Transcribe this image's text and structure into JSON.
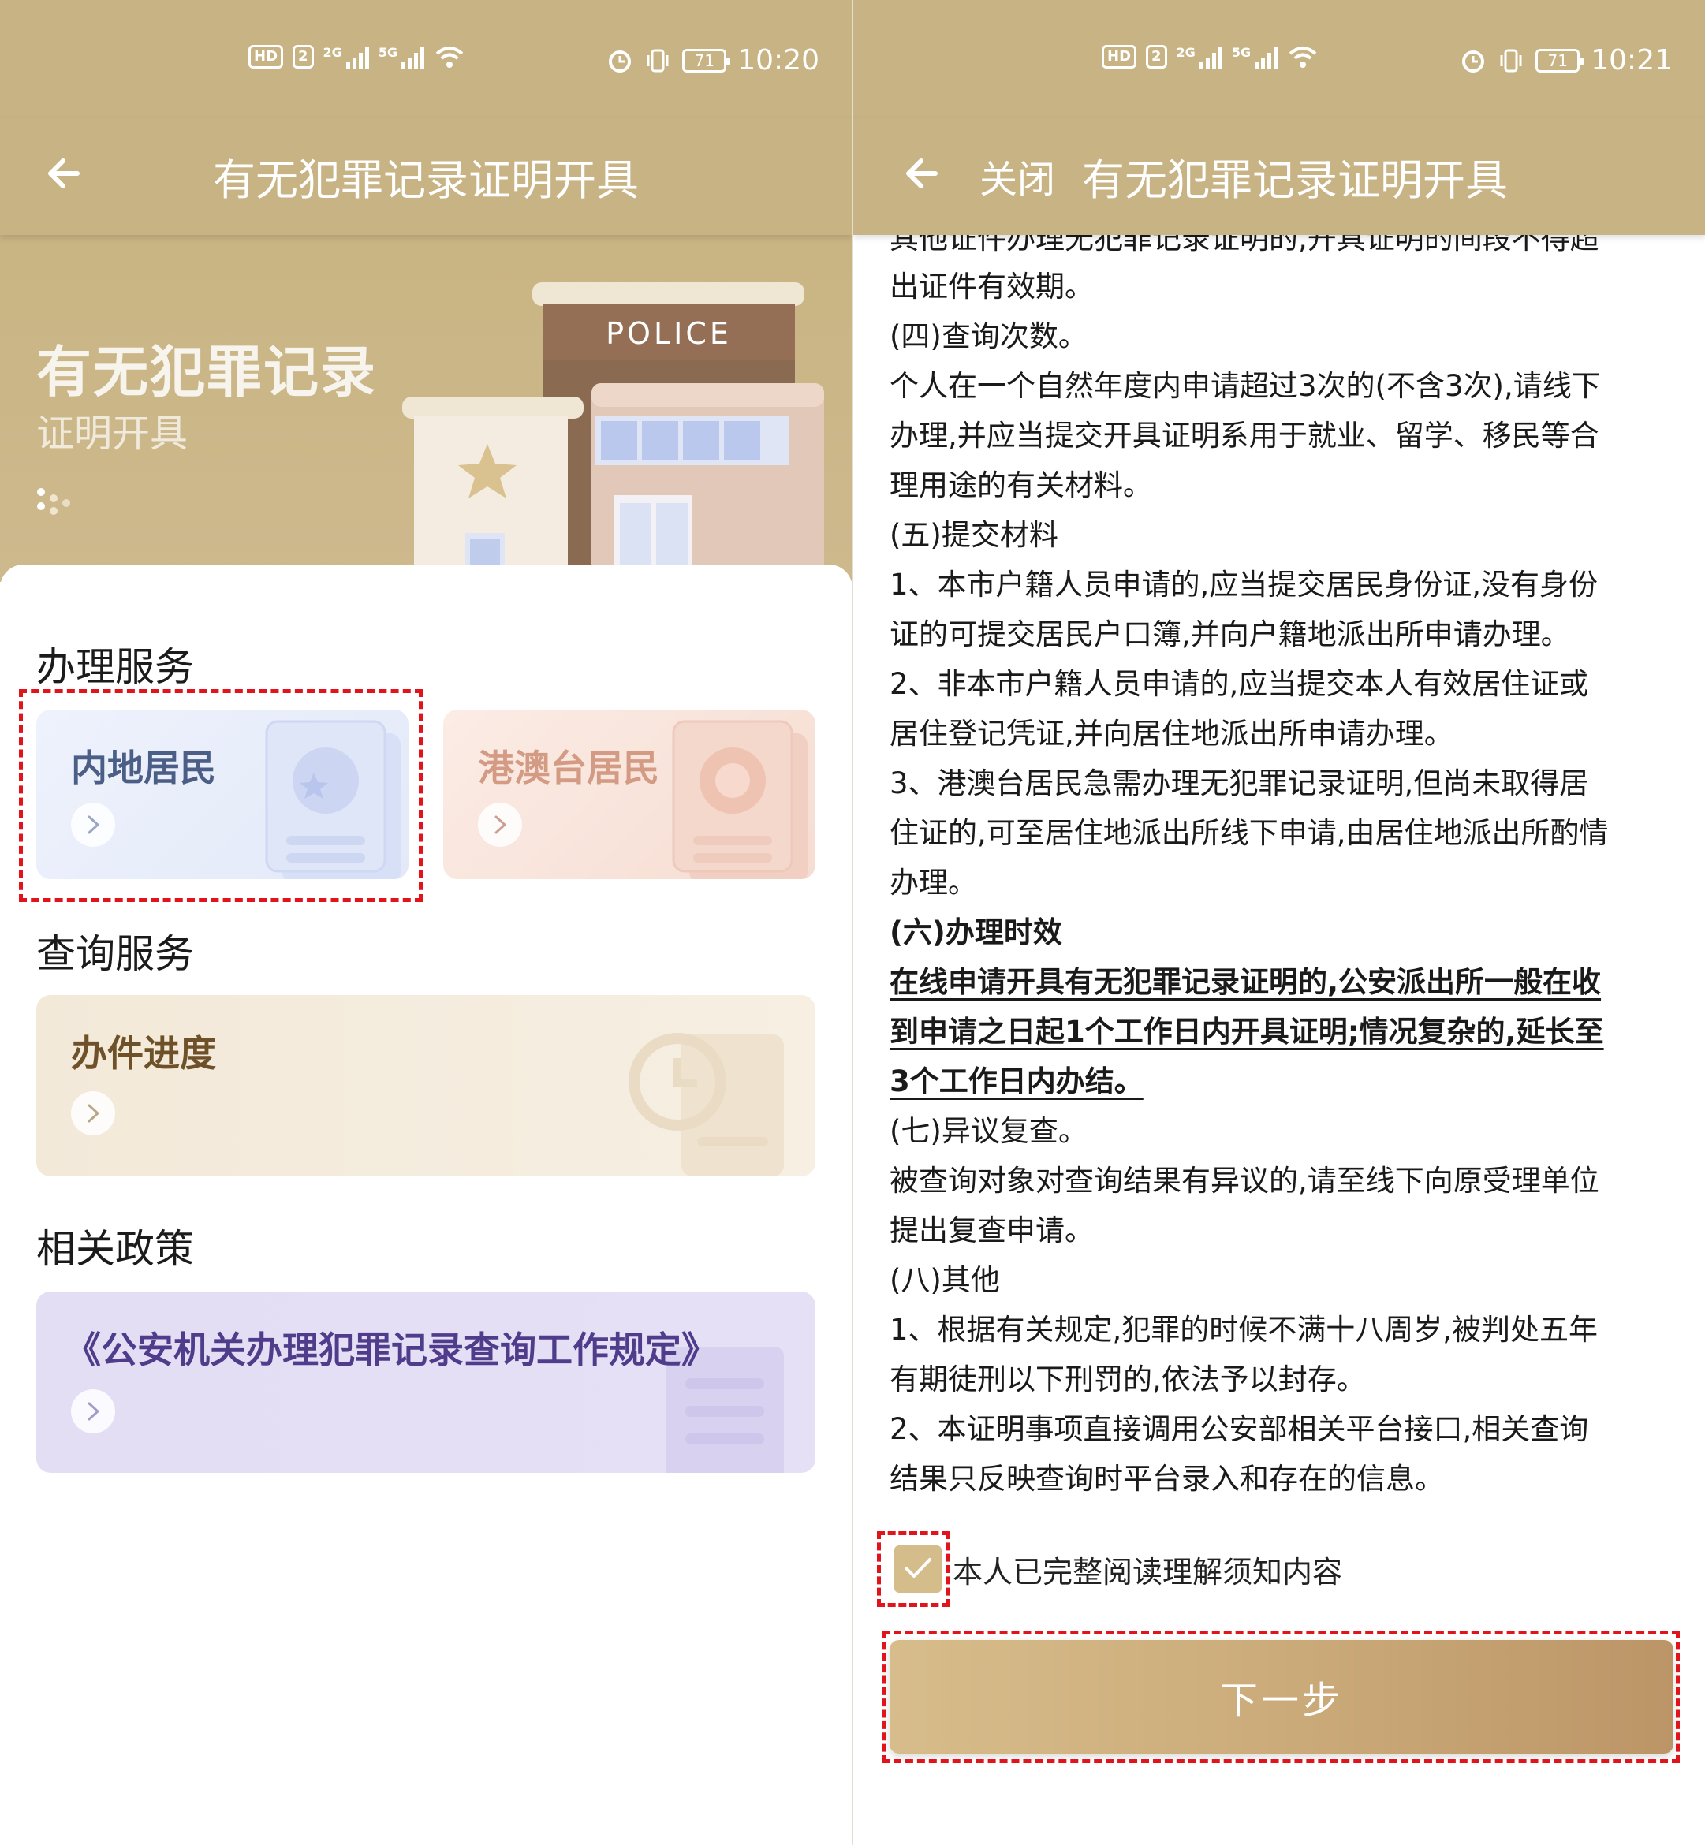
{
  "left": {
    "status": {
      "network": "HD",
      "sim": "2",
      "net1": "2G",
      "net2": "5G",
      "battery": "71",
      "time": "10:20"
    },
    "header": {
      "title": "有无犯罪记录证明开具"
    },
    "banner": {
      "title": "有无犯罪记录",
      "subtitle": "证明开具",
      "sign": "POLICE"
    },
    "sections": {
      "service": "办理服务",
      "query": "查询服务",
      "policy": "相关政策"
    },
    "cards": {
      "mainland": "内地居民",
      "hkmt": "港澳台居民",
      "progress": "办件进度",
      "regulation": "《公安机关办理犯罪记录查询工作规定》"
    }
  },
  "right": {
    "status": {
      "network": "HD",
      "sim": "2",
      "net1": "2G",
      "net2": "5G",
      "battery": "71",
      "time": "10:21"
    },
    "header": {
      "close": "关闭",
      "title": "有无犯罪记录证明开具"
    },
    "notice": {
      "cut_line": "其他证件办理无犯罪记录证明的,开具证明的间段不得超",
      "lines": [
        "出证件有效期。",
        "(四)查询次数。",
        "个人在一个自然年度内申请超过3次的(不含3次),请线下",
        "办理,并应当提交开具证明系用于就业、留学、移民等合",
        "理用途的有关材料。",
        "(五)提交材料",
        "1、本市户籍人员申请的,应当提交居民身份证,没有身份",
        "证的可提交居民户口簿,并向户籍地派出所申请办理。",
        "2、非本市户籍人员申请的,应当提交本人有效居住证或",
        "居住登记凭证,并向居住地派出所申请办理。",
        "3、港澳台居民急需办理无犯罪记录证明,但尚未取得居",
        "住证的,可至居住地派出所线下申请,由居住地派出所酌情",
        "办理。",
        "(六)办理时效",
        "在线申请开具有无犯罪记录证明的,公安派出所一般在收",
        "到申请之日起1个工作日内开具证明;情况复杂的,延长至",
        "3个工作日内办结。",
        "(七)异议复查。",
        "被查询对象对查询结果有异议的,请至线下向原受理单位",
        "提出复查申请。",
        "(八)其他",
        "1、根据有关规定,犯罪的时候不满十八周岁,被判处五年",
        "有期徒刑以下刑罚的,依法予以封存。",
        "2、本证明事项直接调用公安部相关平台接口,相关查询",
        "结果只反映查询时平台录入和存在的信息。"
      ]
    },
    "agree": {
      "label": "本人已完整阅读理解须知内容"
    },
    "next": {
      "label": "下一步"
    }
  },
  "colors": {
    "header": "#c8b384",
    "highlight": "#e0141a",
    "button_start": "#d7bd8b",
    "button_end": "#bc9567"
  },
  "icons": [
    "back-arrow-icon",
    "signal-icon",
    "wifi-icon",
    "alarm-icon",
    "vibrate-icon",
    "battery-icon",
    "chevron-right-icon",
    "check-icon",
    "police-building-illustration"
  ]
}
